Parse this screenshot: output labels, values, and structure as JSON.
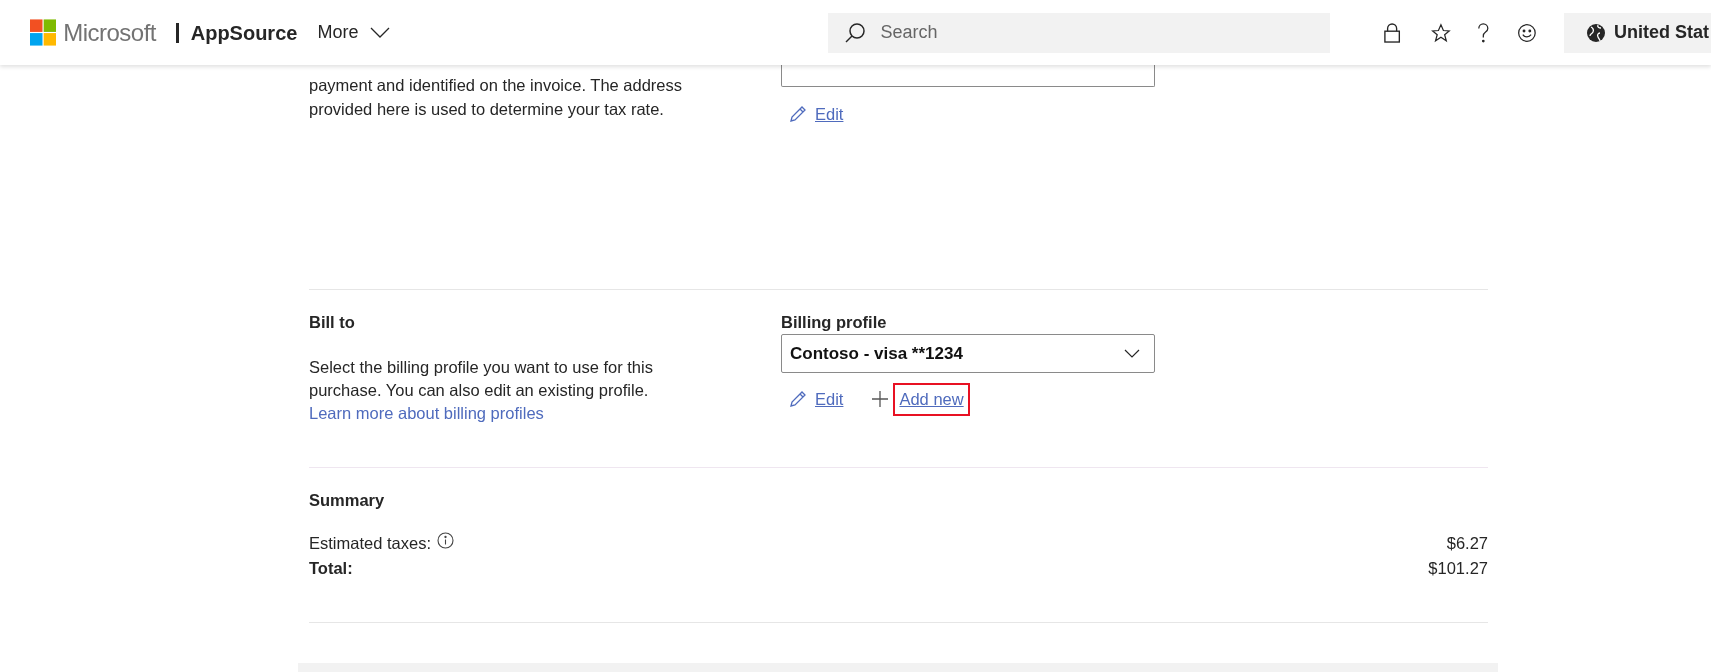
{
  "header": {
    "brand": "Microsoft",
    "product": "AppSource",
    "menu": "More",
    "search": {
      "placeholder": "Search"
    },
    "region": "United Stat"
  },
  "sold_to": {
    "description": "payment and identified on the invoice. The address provided here is used to determine your tax rate.",
    "actions": [
      {
        "kind": "edit",
        "label": "Edit",
        "highlighted": false
      }
    ]
  },
  "bill_to": {
    "title": "Bill to",
    "description": "Select the billing profile you want to use for this purchase. You can also edit an existing profile. ",
    "link": "Learn more about billing profiles",
    "field_label": "Billing profile",
    "value": "Contoso - visa **1234",
    "actions": [
      {
        "kind": "edit",
        "label": "Edit",
        "highlighted": false
      },
      {
        "kind": "add",
        "label": "Add new",
        "highlighted": true
      }
    ]
  },
  "summary": {
    "title": "Summary",
    "rows": [
      {
        "label": "Estimated taxes:",
        "value": "$6.27",
        "bold": false,
        "info": true
      },
      {
        "label": "Total:",
        "value": "$101.27",
        "bold": true,
        "info": false
      }
    ]
  }
}
